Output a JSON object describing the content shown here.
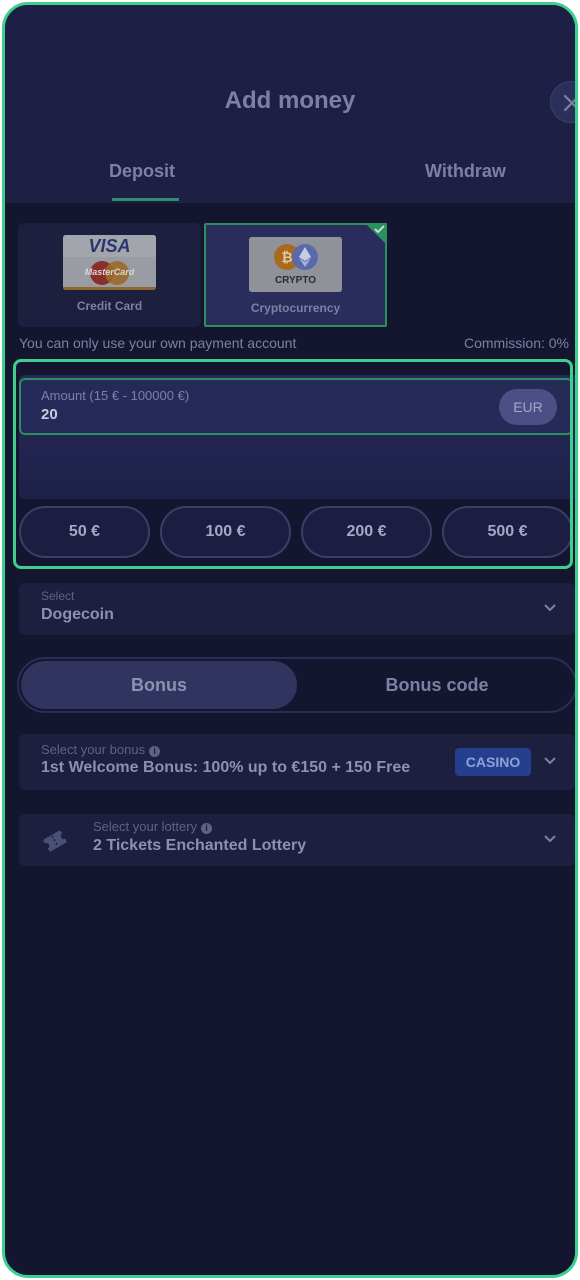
{
  "header": {
    "title": "Add money",
    "close_icon": "close-icon"
  },
  "tabs": [
    {
      "label": "Deposit",
      "active": true
    },
    {
      "label": "Withdraw",
      "active": false
    }
  ],
  "payment_methods": [
    {
      "label": "Credit Card",
      "logo_text_top": "VISA",
      "logo_text_bottom": "MasterCard",
      "selected": false
    },
    {
      "label": "Cryptocurrency",
      "logo_text": "CRYPTO",
      "selected": true
    }
  ],
  "notes": {
    "own_account": "You can only use your own payment account",
    "commission": "Commission: 0%"
  },
  "amount": {
    "label": "Amount (15 € - 100000 €)",
    "value": "20",
    "currency": "EUR"
  },
  "quick_amounts": [
    "50 €",
    "100 €",
    "200 €",
    "500 €"
  ],
  "coin_select": {
    "label": "Select",
    "value": "Dogecoin"
  },
  "bonus_toggle": {
    "active": "Bonus",
    "inactive": "Bonus code"
  },
  "bonus_select": {
    "label": "Select your bonus",
    "value": "1st Welcome Bonus: 100% up to €150 + 150 Free",
    "badge": "CASINO"
  },
  "lottery_select": {
    "label": "Select your lottery",
    "value": "2 Tickets Enchanted Lottery"
  },
  "colors": {
    "accent_green": "#3ecf8e",
    "background": "#14162f",
    "badge_blue": "#263e8e"
  }
}
